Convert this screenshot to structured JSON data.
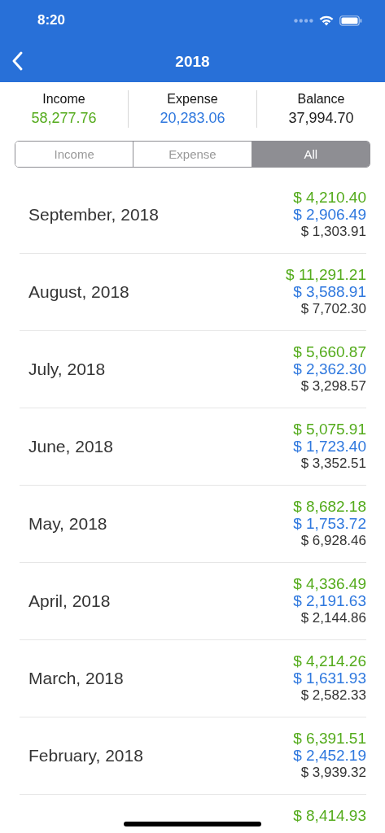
{
  "status_bar": {
    "time": "8:20"
  },
  "nav": {
    "title": "2018"
  },
  "summary": [
    {
      "label": "Income",
      "value": "58,277.76",
      "kind": "income"
    },
    {
      "label": "Expense",
      "value": "20,283.06",
      "kind": "expense"
    },
    {
      "label": "Balance",
      "value": "37,994.70",
      "kind": "balance"
    }
  ],
  "segments": [
    {
      "label": "Income",
      "selected": false
    },
    {
      "label": "Expense",
      "selected": false
    },
    {
      "label": "All",
      "selected": true
    }
  ],
  "months": [
    {
      "month": "September, 2018",
      "income": "$ 4,210.40",
      "expense": "$ 2,906.49",
      "balance": "$ 1,303.91"
    },
    {
      "month": "August, 2018",
      "income": "$ 11,291.21",
      "expense": "$ 3,588.91",
      "balance": "$ 7,702.30"
    },
    {
      "month": "July, 2018",
      "income": "$ 5,660.87",
      "expense": "$ 2,362.30",
      "balance": "$ 3,298.57"
    },
    {
      "month": "June, 2018",
      "income": "$ 5,075.91",
      "expense": "$ 1,723.40",
      "balance": "$ 3,352.51"
    },
    {
      "month": "May, 2018",
      "income": "$ 8,682.18",
      "expense": "$ 1,753.72",
      "balance": "$ 6,928.46"
    },
    {
      "month": "April, 2018",
      "income": "$ 4,336.49",
      "expense": "$ 2,191.63",
      "balance": "$ 2,144.86"
    },
    {
      "month": "March, 2018",
      "income": "$ 4,214.26",
      "expense": "$ 1,631.93",
      "balance": "$ 2,582.33"
    },
    {
      "month": "February, 2018",
      "income": "$ 6,391.51",
      "expense": "$ 2,452.19",
      "balance": "$ 3,939.32"
    },
    {
      "income": "$ 8,414.93"
    }
  ]
}
